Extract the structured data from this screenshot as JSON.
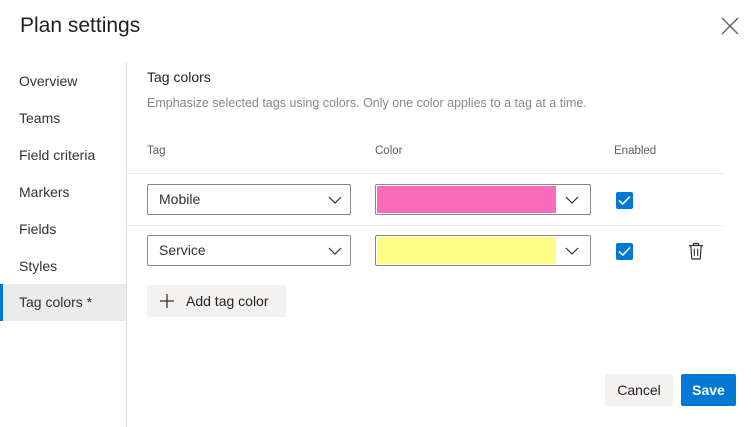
{
  "dialog": {
    "title": "Plan settings"
  },
  "nav": {
    "items": [
      {
        "label": "Overview"
      },
      {
        "label": "Teams"
      },
      {
        "label": "Field criteria"
      },
      {
        "label": "Markers"
      },
      {
        "label": "Fields"
      },
      {
        "label": "Styles"
      },
      {
        "label": "Tag colors *"
      }
    ],
    "selected": "Tag colors *"
  },
  "tag_colors": {
    "title": "Tag colors",
    "description": "Emphasize selected tags using colors. Only one color applies to a tag at a time.",
    "columns": {
      "tag": "Tag",
      "color": "Color",
      "enabled": "Enabled"
    },
    "rows": [
      {
        "tag": "Mobile",
        "color": "#f76bb9",
        "enabled": true
      },
      {
        "tag": "Service",
        "color": "#fdfd85",
        "enabled": true
      }
    ],
    "add_label": "Add tag color"
  },
  "footer": {
    "cancel_label": "Cancel",
    "save_label": "Save"
  },
  "theme": {
    "accent": "#0078d4"
  },
  "icons": {
    "close": "close-icon",
    "chevron": "chevron-down-icon",
    "check": "checkmark-icon",
    "trash": "trash-icon",
    "plus": "plus-icon"
  }
}
